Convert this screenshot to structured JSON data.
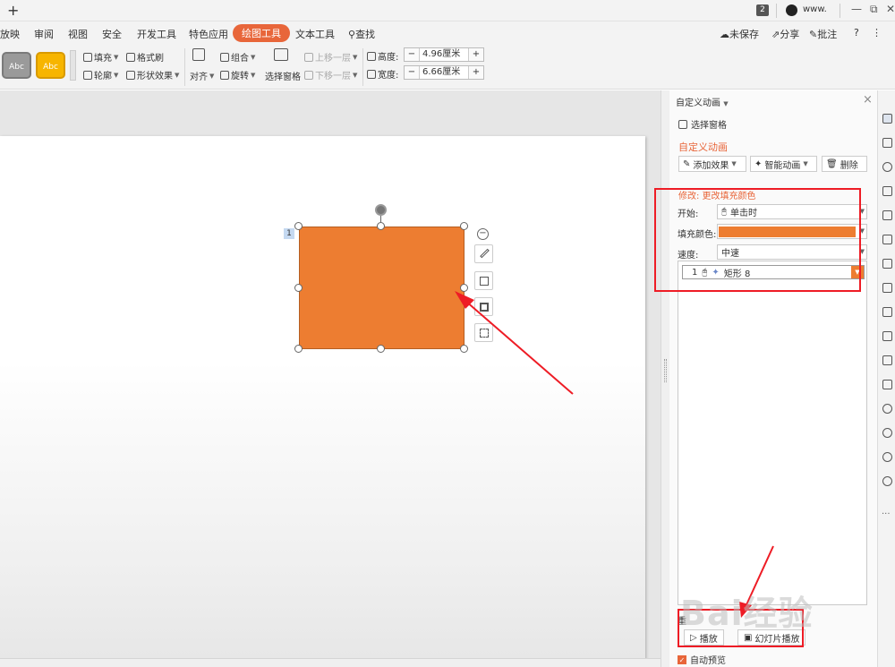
{
  "titlebar": {
    "tab_count": "2",
    "user": "www.",
    "buttons": [
      "—",
      "⧉",
      "✕"
    ]
  },
  "menu": {
    "items": [
      "放映",
      "审阅",
      "视图",
      "安全",
      "开发工具",
      "特色应用",
      "绘图工具",
      "文本工具",
      "查找"
    ],
    "active": "绘图工具",
    "right": {
      "unsaved": "未保存",
      "share": "分享",
      "comment": "批注",
      "help": "?",
      "more": "⋮"
    }
  },
  "ribbon": {
    "styles": [
      "Abc",
      "Abc"
    ],
    "fill": "填充",
    "format_painter": "格式刷",
    "outline": "轮廓",
    "shape_effect": "形状效果",
    "align": "对齐",
    "group": "组合",
    "rotate": "旋转",
    "selection_pane": "选择窗格",
    "bring_forward": "上移一层",
    "send_backward": "下移一层",
    "height_label": "高度:",
    "height_value": "4.96厘米",
    "width_label": "宽度:",
    "width_value": "6.66厘米"
  },
  "slide": {
    "anim_tag": "1",
    "shape_color": "#ed7d31"
  },
  "pane": {
    "title": "自定义动画",
    "selection_pane": "选择窗格",
    "heading": "自定义动画",
    "add_effect": "添加效果",
    "smart_anim": "智能动画",
    "delete": "删除",
    "modify": "修改: 更改填充颜色",
    "start_label": "开始:",
    "start_value": "单击时",
    "fill_label": "填充颜色:",
    "speed_label": "速度:",
    "speed_value": "中速",
    "list_item_num": "1",
    "list_item_name": "矩形 8",
    "reorder": "重",
    "play": "播放",
    "slideshow": "幻灯片播放",
    "auto_preview": "自动预览"
  },
  "watermark": "Bai经验"
}
